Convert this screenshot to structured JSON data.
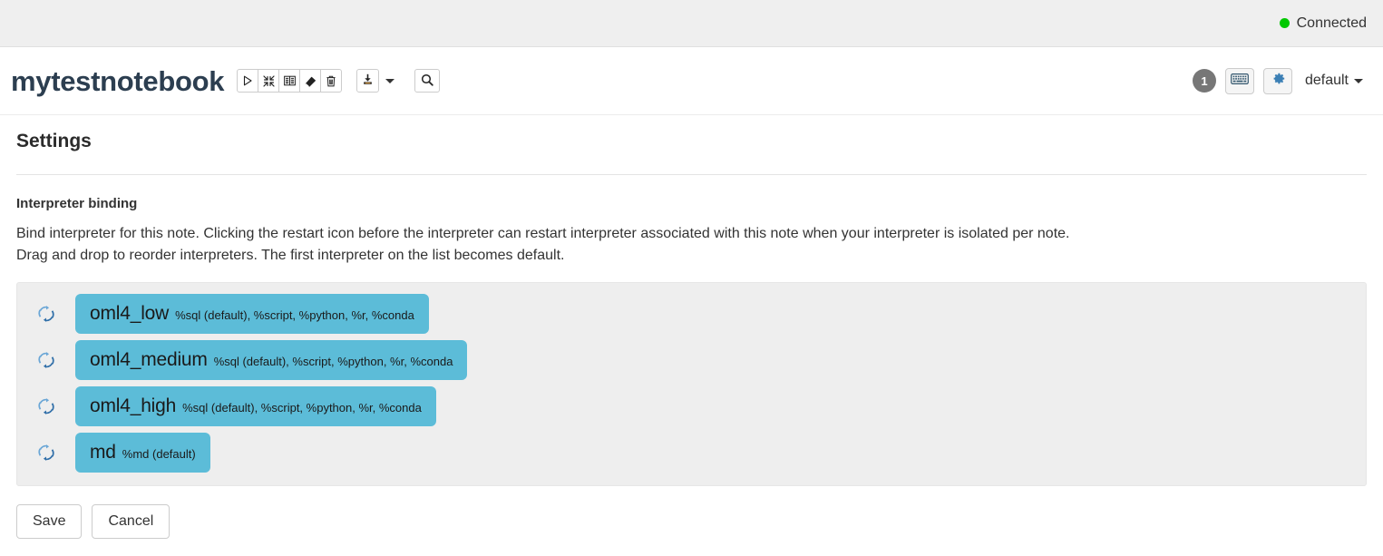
{
  "statusbar": {
    "connection_label": "Connected",
    "connection_color": "#00c800",
    "connection_icon": "green-dot-icon"
  },
  "header": {
    "note_title": "mytestnotebook",
    "toolbar": [
      {
        "name": "run-all-paragraphs-button",
        "icon": "play-icon"
      },
      {
        "name": "hide-show-all-code-button",
        "icon": "collapse-arrows-icon"
      },
      {
        "name": "show-hide-all-output-button",
        "icon": "book-icon"
      },
      {
        "name": "clear-all-output-button",
        "icon": "eraser-icon"
      },
      {
        "name": "remove-notebook-button",
        "icon": "trash-icon"
      }
    ],
    "export_button": {
      "name": "export-notebook-button",
      "icon": "download-icon"
    },
    "search_button": {
      "name": "search-code-button",
      "icon": "search-icon"
    },
    "revision_badge": "1",
    "keyboard_shortcuts_button": {
      "name": "keyboard-shortcuts-button",
      "icon": "keyboard-icon"
    },
    "settings_button": {
      "name": "interpreter-settings-button",
      "icon": "gear-icon",
      "active_color": "#3b7fb5"
    },
    "permissions_dropdown": "default"
  },
  "settings": {
    "title": "Settings",
    "section_heading": "Interpreter binding",
    "description_line1": "Bind interpreter for this note. Clicking the restart icon before the interpreter can restart interpreter associated with this note when your interpreter is isolated per note.",
    "description_line2": "Drag and drop to reorder interpreters. The first interpreter on the list becomes default.",
    "pill_color": "#5cbcd8",
    "interpreters": [
      {
        "name": "oml4_low",
        "modes": "%sql (default), %script, %python, %r, %conda",
        "restart_icon": "restart-icon"
      },
      {
        "name": "oml4_medium",
        "modes": "%sql (default), %script, %python, %r, %conda",
        "restart_icon": "restart-icon"
      },
      {
        "name": "oml4_high",
        "modes": "%sql (default), %script, %python, %r, %conda",
        "restart_icon": "restart-icon"
      },
      {
        "name": "md",
        "modes": "%md (default)",
        "restart_icon": "restart-icon"
      }
    ],
    "save_label": "Save",
    "cancel_label": "Cancel"
  }
}
